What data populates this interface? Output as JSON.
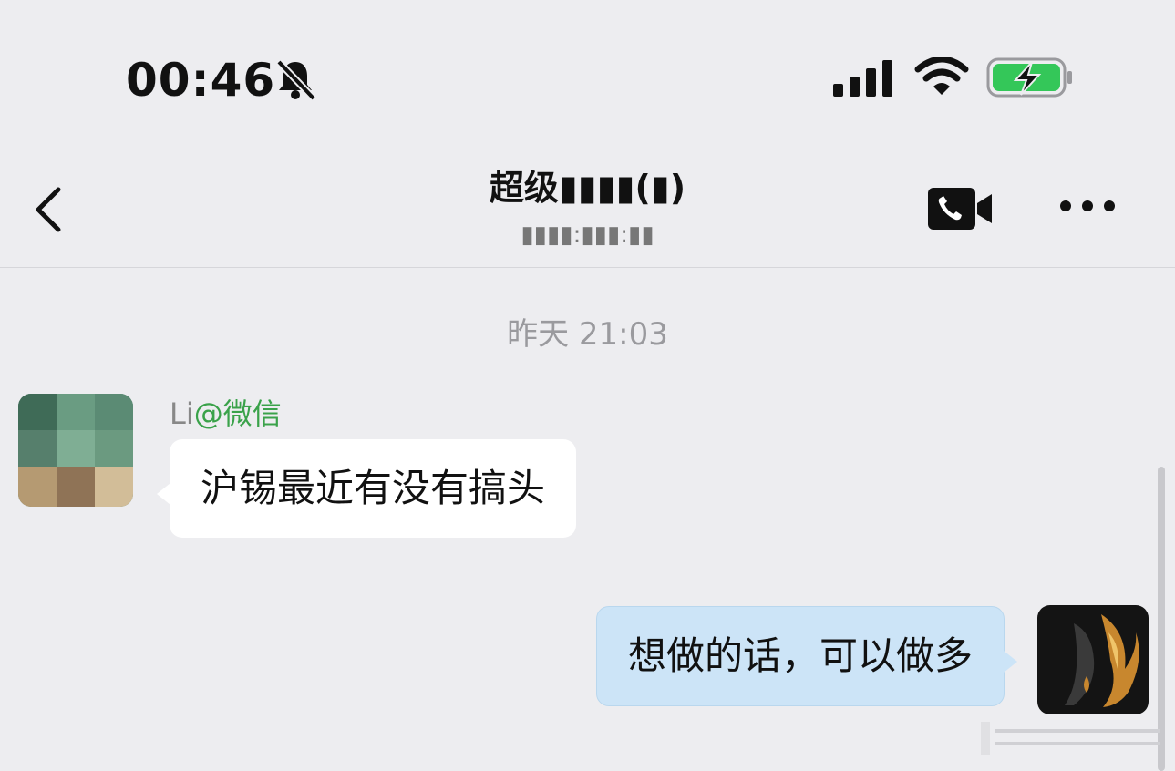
{
  "status_bar": {
    "time": "00:46",
    "icons": [
      "bell-muted-icon",
      "cellular-signal-icon",
      "wifi-icon",
      "battery-charging-icon"
    ],
    "battery_color": "#34c759"
  },
  "nav": {
    "title": "超级▮▮▮▮(▮)",
    "subtitle": "▮▮▮▮:▮▮▮:▮▮",
    "back_icon": "chevron-left-icon",
    "call_icon": "video-call-icon",
    "more_icon": "more-dots-icon"
  },
  "timestamp": "昨天 21:03",
  "messages": [
    {
      "direction": "incoming",
      "sender_name": "Li",
      "sender_tag": "@微信",
      "text": "沪锡最近有没有搞头"
    },
    {
      "direction": "outgoing",
      "text": "想做的话，可以做多"
    }
  ],
  "colors": {
    "background": "#ededf0",
    "incoming_bubble": "#ffffff",
    "outgoing_bubble": "#cce4f7",
    "sender_tag": "#3aa24a",
    "timestamp": "#9a9a9e"
  }
}
